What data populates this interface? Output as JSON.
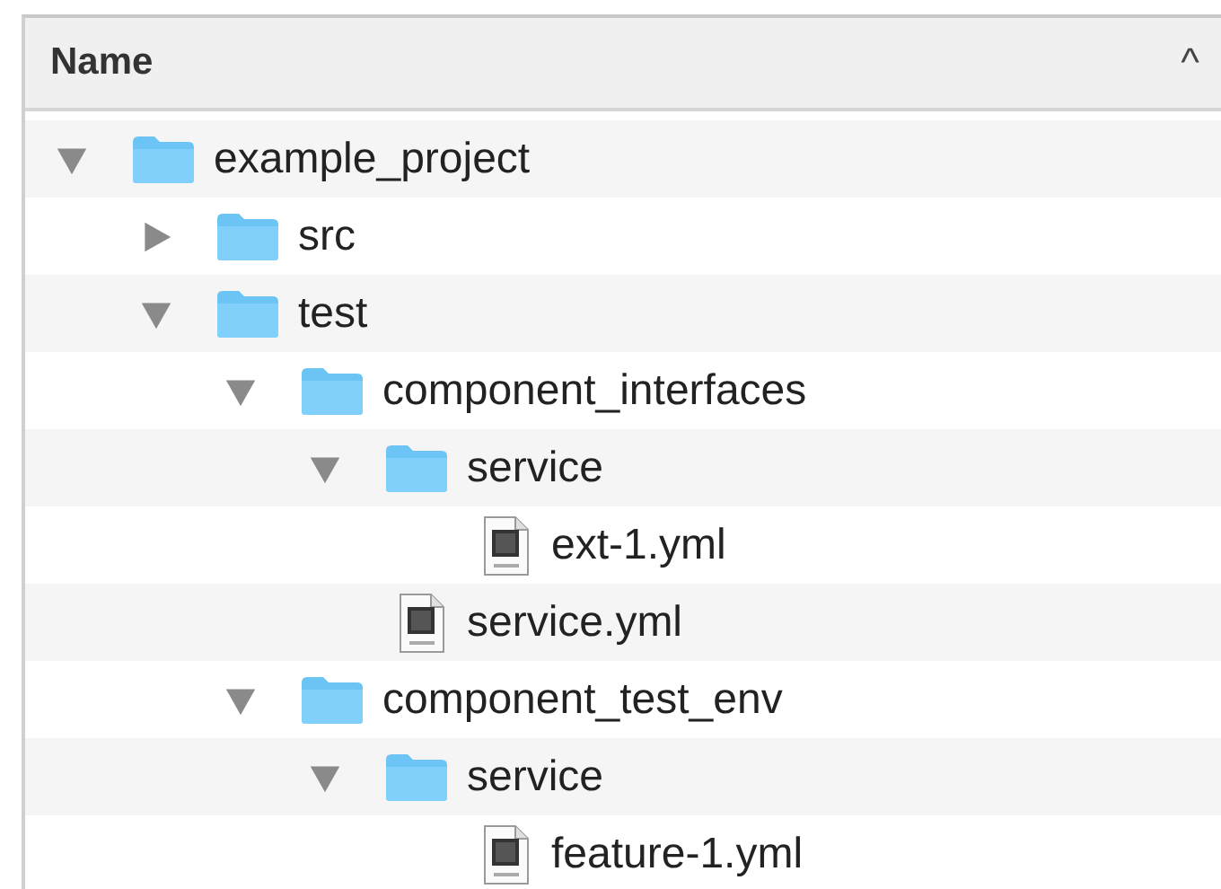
{
  "header": {
    "label": "Name",
    "sort_arrow": "^"
  },
  "tree": [
    {
      "name": "example_project",
      "kind": "folder",
      "expanded": true,
      "children": [
        {
          "name": "src",
          "kind": "folder",
          "expanded": false
        },
        {
          "name": "test",
          "kind": "folder",
          "expanded": true,
          "children": [
            {
              "name": "component_interfaces",
              "kind": "folder",
              "expanded": true,
              "children": [
                {
                  "name": "service",
                  "kind": "folder",
                  "expanded": true,
                  "children": [
                    {
                      "name": "ext-1.yml",
                      "kind": "file"
                    }
                  ]
                },
                {
                  "name": "service.yml",
                  "kind": "file"
                }
              ]
            },
            {
              "name": "component_test_env",
              "kind": "folder",
              "expanded": true,
              "children": [
                {
                  "name": "service",
                  "kind": "folder",
                  "expanded": true,
                  "children": [
                    {
                      "name": "feature-1.yml",
                      "kind": "file"
                    }
                  ]
                }
              ]
            }
          ]
        }
      ]
    }
  ]
}
